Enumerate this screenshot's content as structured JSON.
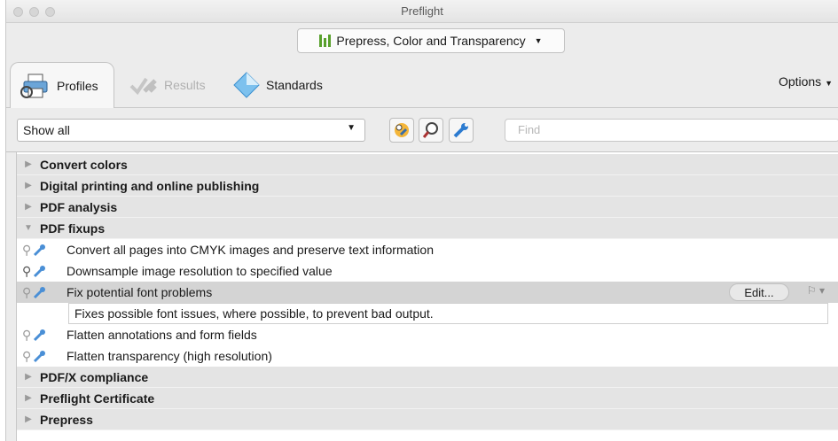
{
  "window": {
    "title": "Preflight"
  },
  "profile_selector": {
    "label": "Prepress, Color and Transparency",
    "icon": "bars-chart-icon",
    "accent": "#58a02c"
  },
  "tabs": [
    {
      "label": "Profiles",
      "icon": "profiles-printer-icon",
      "active": true
    },
    {
      "label": "Results",
      "icon": "results-icon",
      "enabled": false
    },
    {
      "label": "Standards",
      "icon": "standards-diamond-icon"
    }
  ],
  "options_label": "Options",
  "toolbar": {
    "filter_value": "Show all",
    "buttons": [
      "profiles-view-icon",
      "checks-search-icon",
      "fixups-wrench-icon"
    ],
    "find_placeholder": "Find"
  },
  "list": {
    "groups_top": [
      "Convert colors",
      "Digital printing and online publishing",
      "PDF analysis"
    ],
    "expanded_group": "PDF fixups",
    "fixups": [
      "Convert all pages into CMYK images and preserve text information",
      "Downsample image resolution to specified value",
      "Fix potential font problems",
      "Flatten annotations and form fields",
      "Flatten transparency (high resolution)"
    ],
    "selected_description": "Fixes possible font issues, where possible, to prevent bad output.",
    "edit_label": "Edit...",
    "groups_bottom": [
      "PDF/X compliance",
      "Preflight Certificate",
      "Prepress"
    ]
  }
}
